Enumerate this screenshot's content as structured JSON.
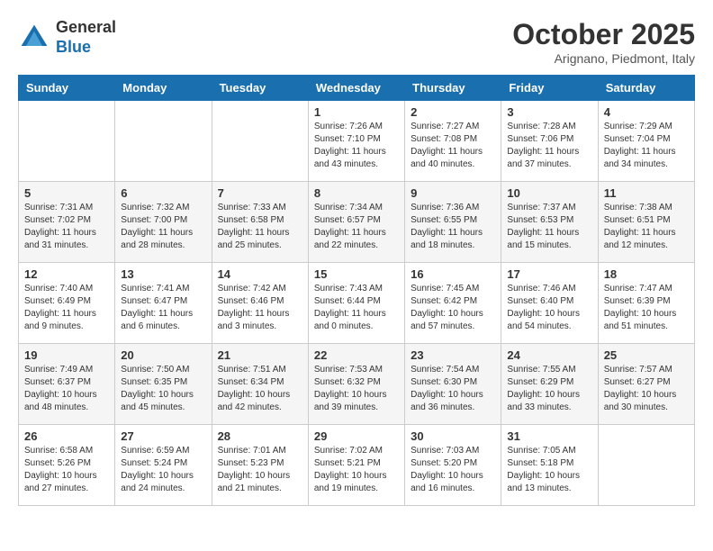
{
  "header": {
    "logo_general": "General",
    "logo_blue": "Blue",
    "month_title": "October 2025",
    "location": "Arignano, Piedmont, Italy"
  },
  "weekdays": [
    "Sunday",
    "Monday",
    "Tuesday",
    "Wednesday",
    "Thursday",
    "Friday",
    "Saturday"
  ],
  "weeks": [
    [
      {
        "day": "",
        "info": ""
      },
      {
        "day": "",
        "info": ""
      },
      {
        "day": "",
        "info": ""
      },
      {
        "day": "1",
        "info": "Sunrise: 7:26 AM\nSunset: 7:10 PM\nDaylight: 11 hours\nand 43 minutes."
      },
      {
        "day": "2",
        "info": "Sunrise: 7:27 AM\nSunset: 7:08 PM\nDaylight: 11 hours\nand 40 minutes."
      },
      {
        "day": "3",
        "info": "Sunrise: 7:28 AM\nSunset: 7:06 PM\nDaylight: 11 hours\nand 37 minutes."
      },
      {
        "day": "4",
        "info": "Sunrise: 7:29 AM\nSunset: 7:04 PM\nDaylight: 11 hours\nand 34 minutes."
      }
    ],
    [
      {
        "day": "5",
        "info": "Sunrise: 7:31 AM\nSunset: 7:02 PM\nDaylight: 11 hours\nand 31 minutes."
      },
      {
        "day": "6",
        "info": "Sunrise: 7:32 AM\nSunset: 7:00 PM\nDaylight: 11 hours\nand 28 minutes."
      },
      {
        "day": "7",
        "info": "Sunrise: 7:33 AM\nSunset: 6:58 PM\nDaylight: 11 hours\nand 25 minutes."
      },
      {
        "day": "8",
        "info": "Sunrise: 7:34 AM\nSunset: 6:57 PM\nDaylight: 11 hours\nand 22 minutes."
      },
      {
        "day": "9",
        "info": "Sunrise: 7:36 AM\nSunset: 6:55 PM\nDaylight: 11 hours\nand 18 minutes."
      },
      {
        "day": "10",
        "info": "Sunrise: 7:37 AM\nSunset: 6:53 PM\nDaylight: 11 hours\nand 15 minutes."
      },
      {
        "day": "11",
        "info": "Sunrise: 7:38 AM\nSunset: 6:51 PM\nDaylight: 11 hours\nand 12 minutes."
      }
    ],
    [
      {
        "day": "12",
        "info": "Sunrise: 7:40 AM\nSunset: 6:49 PM\nDaylight: 11 hours\nand 9 minutes."
      },
      {
        "day": "13",
        "info": "Sunrise: 7:41 AM\nSunset: 6:47 PM\nDaylight: 11 hours\nand 6 minutes."
      },
      {
        "day": "14",
        "info": "Sunrise: 7:42 AM\nSunset: 6:46 PM\nDaylight: 11 hours\nand 3 minutes."
      },
      {
        "day": "15",
        "info": "Sunrise: 7:43 AM\nSunset: 6:44 PM\nDaylight: 11 hours\nand 0 minutes."
      },
      {
        "day": "16",
        "info": "Sunrise: 7:45 AM\nSunset: 6:42 PM\nDaylight: 10 hours\nand 57 minutes."
      },
      {
        "day": "17",
        "info": "Sunrise: 7:46 AM\nSunset: 6:40 PM\nDaylight: 10 hours\nand 54 minutes."
      },
      {
        "day": "18",
        "info": "Sunrise: 7:47 AM\nSunset: 6:39 PM\nDaylight: 10 hours\nand 51 minutes."
      }
    ],
    [
      {
        "day": "19",
        "info": "Sunrise: 7:49 AM\nSunset: 6:37 PM\nDaylight: 10 hours\nand 48 minutes."
      },
      {
        "day": "20",
        "info": "Sunrise: 7:50 AM\nSunset: 6:35 PM\nDaylight: 10 hours\nand 45 minutes."
      },
      {
        "day": "21",
        "info": "Sunrise: 7:51 AM\nSunset: 6:34 PM\nDaylight: 10 hours\nand 42 minutes."
      },
      {
        "day": "22",
        "info": "Sunrise: 7:53 AM\nSunset: 6:32 PM\nDaylight: 10 hours\nand 39 minutes."
      },
      {
        "day": "23",
        "info": "Sunrise: 7:54 AM\nSunset: 6:30 PM\nDaylight: 10 hours\nand 36 minutes."
      },
      {
        "day": "24",
        "info": "Sunrise: 7:55 AM\nSunset: 6:29 PM\nDaylight: 10 hours\nand 33 minutes."
      },
      {
        "day": "25",
        "info": "Sunrise: 7:57 AM\nSunset: 6:27 PM\nDaylight: 10 hours\nand 30 minutes."
      }
    ],
    [
      {
        "day": "26",
        "info": "Sunrise: 6:58 AM\nSunset: 5:26 PM\nDaylight: 10 hours\nand 27 minutes."
      },
      {
        "day": "27",
        "info": "Sunrise: 6:59 AM\nSunset: 5:24 PM\nDaylight: 10 hours\nand 24 minutes."
      },
      {
        "day": "28",
        "info": "Sunrise: 7:01 AM\nSunset: 5:23 PM\nDaylight: 10 hours\nand 21 minutes."
      },
      {
        "day": "29",
        "info": "Sunrise: 7:02 AM\nSunset: 5:21 PM\nDaylight: 10 hours\nand 19 minutes."
      },
      {
        "day": "30",
        "info": "Sunrise: 7:03 AM\nSunset: 5:20 PM\nDaylight: 10 hours\nand 16 minutes."
      },
      {
        "day": "31",
        "info": "Sunrise: 7:05 AM\nSunset: 5:18 PM\nDaylight: 10 hours\nand 13 minutes."
      },
      {
        "day": "",
        "info": ""
      }
    ]
  ]
}
